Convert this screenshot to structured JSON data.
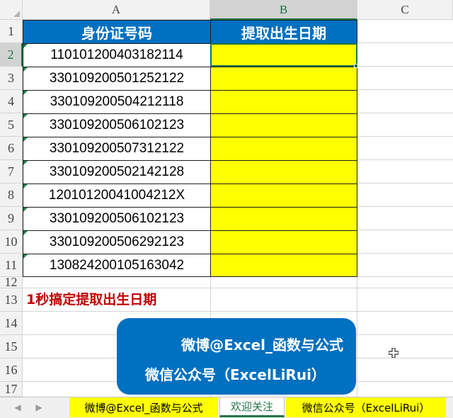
{
  "columns": [
    "A",
    "B",
    "C"
  ],
  "rows": [
    "1",
    "2",
    "3",
    "4",
    "5",
    "6",
    "7",
    "8",
    "9",
    "10",
    "11",
    "12",
    "13",
    "14",
    "15",
    "16",
    "17"
  ],
  "selected_column": "B",
  "selected_row": "2",
  "table": {
    "header_a": "身份证号码",
    "header_b": "提取出生日期",
    "ids": [
      "110101200403182114",
      "330109200501252122",
      "330109200504212118",
      "330109200506102123",
      "330109200507312122",
      "330109200502142128",
      "12010120041004212X",
      "330109200506102123",
      "330109200506292123",
      "130824200105163042"
    ]
  },
  "note": "1秒搞定提取出生日期",
  "banner": {
    "line1": "微博@Excel_函数与公式",
    "line2": "微信公众号（ExcelLiRui）"
  },
  "tabs": [
    {
      "label": "微博@Excel_函数与公式",
      "style": "yellow"
    },
    {
      "label": "欢迎关注",
      "style": "active"
    },
    {
      "label": "微信公众号（ExcelLiRui）",
      "style": "yellow"
    }
  ],
  "colors": {
    "header_fill": "#0070c0",
    "date_fill": "#ffff00",
    "note_text": "#c00000",
    "excel_green": "#217346"
  }
}
